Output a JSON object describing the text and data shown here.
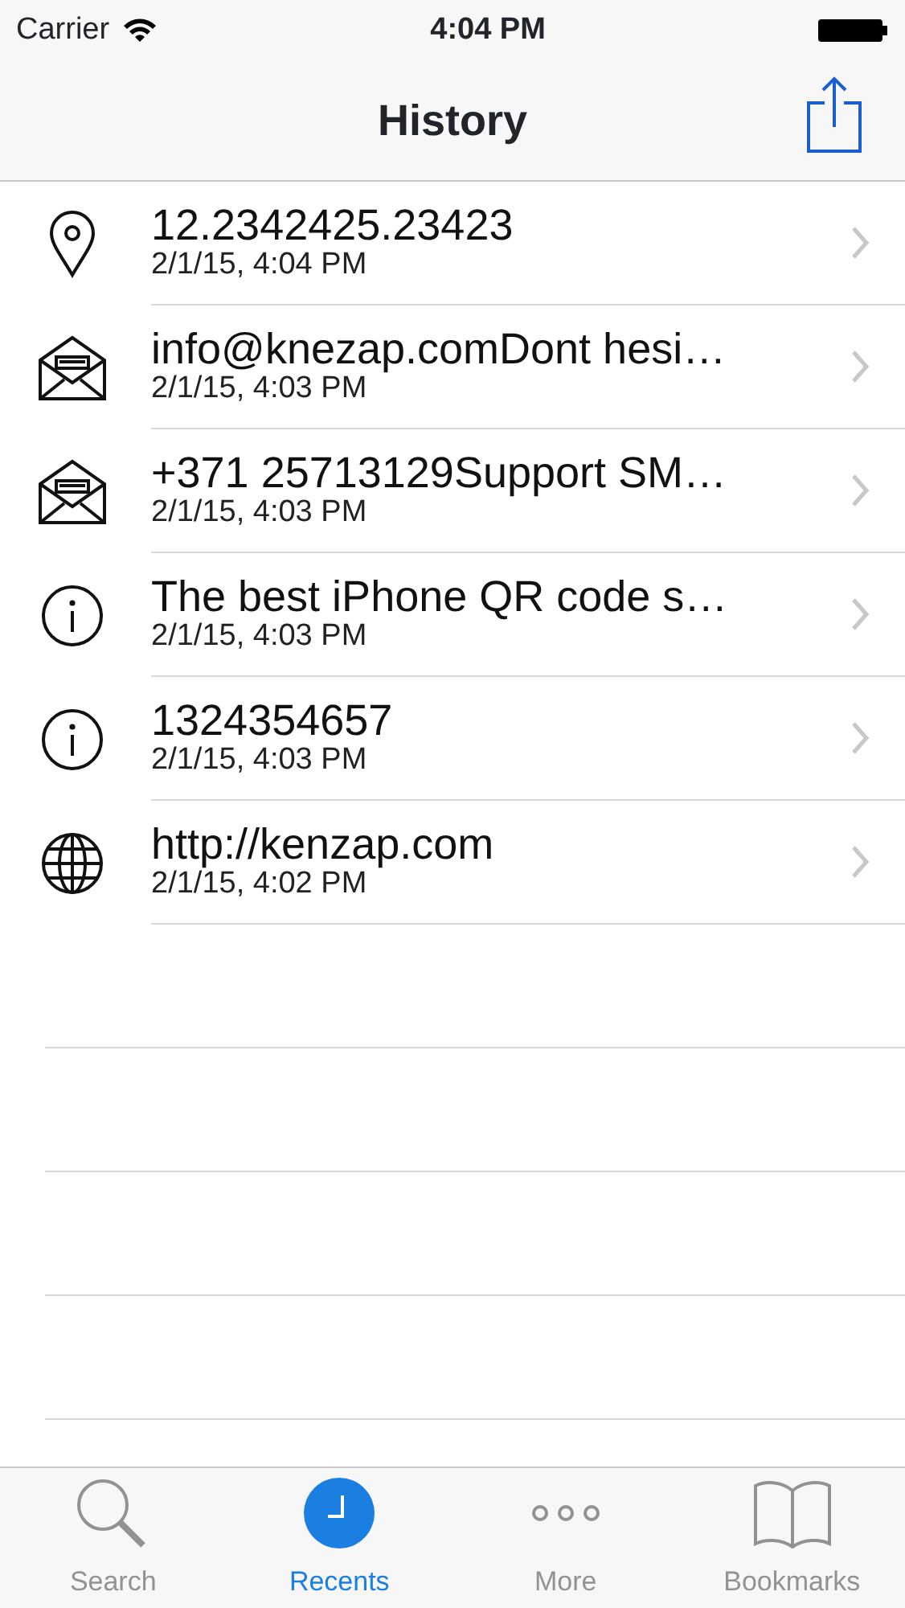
{
  "status_bar": {
    "carrier": "Carrier",
    "time": "4:04 PM"
  },
  "nav": {
    "title": "History"
  },
  "rows": [
    {
      "kind": "location",
      "title": "12.2342425.23423",
      "date": "2/1/15, 4:04 PM"
    },
    {
      "kind": "message",
      "title": "info@knezap.comDont hesi…",
      "date": "2/1/15, 4:03 PM"
    },
    {
      "kind": "message",
      "title": "+371 25713129Support SM…",
      "date": "2/1/15, 4:03 PM"
    },
    {
      "kind": "info",
      "title": "The best iPhone QR code s…",
      "date": "2/1/15, 4:03 PM"
    },
    {
      "kind": "info",
      "title": "1324354657",
      "date": "2/1/15, 4:03 PM"
    },
    {
      "kind": "web",
      "title": "http://kenzap.com",
      "date": "2/1/15, 4:02 PM"
    }
  ],
  "tabs": [
    {
      "kind": "search",
      "label": "Search",
      "selected": false
    },
    {
      "kind": "recents",
      "label": "Recents",
      "selected": true
    },
    {
      "kind": "more",
      "label": "More",
      "selected": false
    },
    {
      "kind": "bookmarks",
      "label": "Bookmarks",
      "selected": false
    }
  ]
}
